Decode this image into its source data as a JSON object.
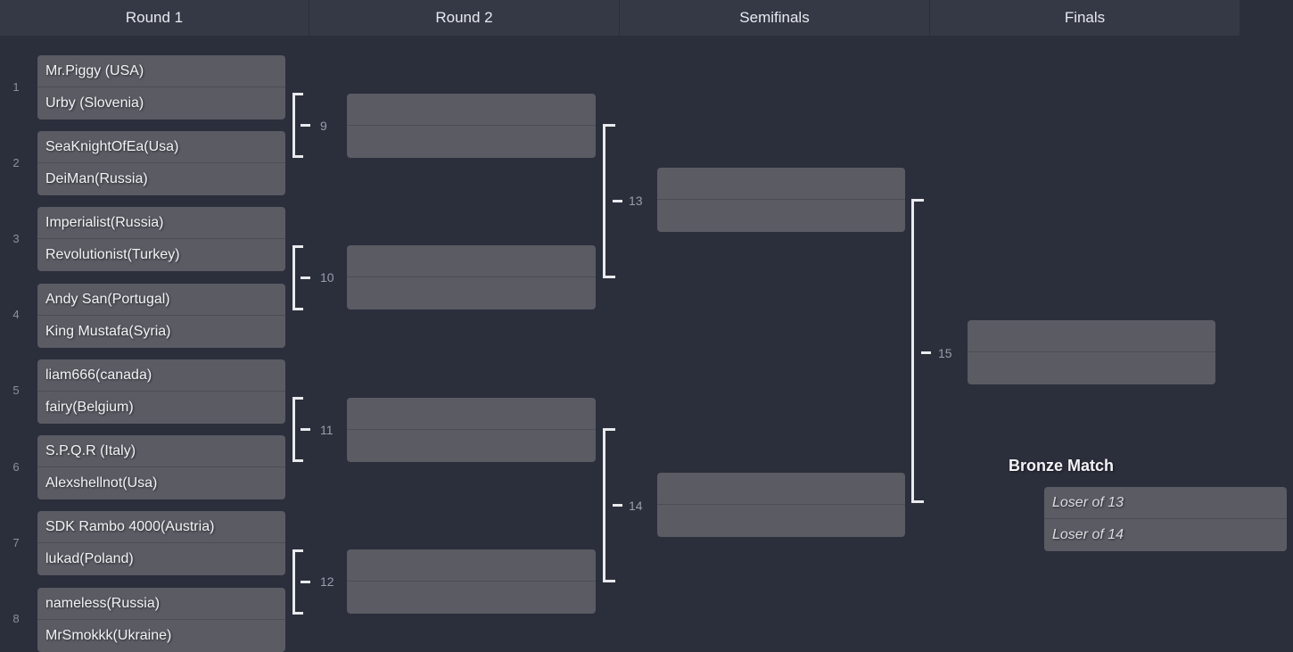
{
  "header": {
    "columns": [
      {
        "label": "Round 1"
      },
      {
        "label": "Round 2"
      },
      {
        "label": "Semifinals"
      },
      {
        "label": "Finals"
      }
    ]
  },
  "round1": {
    "matches": [
      {
        "number": "1",
        "top": "Mr.Piggy (USA)",
        "bottom": "Urby (Slovenia)"
      },
      {
        "number": "2",
        "top": "SeaKnightOfEa(Usa)",
        "bottom": "DeiMan(Russia)"
      },
      {
        "number": "3",
        "top": "Imperialist(Russia)",
        "bottom": "Revolutionist(Turkey)"
      },
      {
        "number": "4",
        "top": "Andy San(Portugal)",
        "bottom": "King Mustafa(Syria)"
      },
      {
        "number": "5",
        "top": "liam666(canada)",
        "bottom": "fairy(Belgium)"
      },
      {
        "number": "6",
        "top": "S.P.Q.R (Italy)",
        "bottom": "Alexshellnot(Usa)"
      },
      {
        "number": "7",
        "top": "SDK Rambo 4000(Austria)",
        "bottom": "lukad(Poland)"
      },
      {
        "number": "8",
        "top": "nameless(Russia)",
        "bottom": "MrSmokkk(Ukraine)"
      }
    ]
  },
  "round2": {
    "matches": [
      {
        "number": "9",
        "top": "",
        "bottom": ""
      },
      {
        "number": "10",
        "top": "",
        "bottom": ""
      },
      {
        "number": "11",
        "top": "",
        "bottom": ""
      },
      {
        "number": "12",
        "top": "",
        "bottom": ""
      }
    ]
  },
  "semifinals": {
    "matches": [
      {
        "number": "13",
        "top": "",
        "bottom": ""
      },
      {
        "number": "14",
        "top": "",
        "bottom": ""
      }
    ]
  },
  "finals": {
    "matches": [
      {
        "number": "15",
        "top": "",
        "bottom": ""
      }
    ]
  },
  "bronze": {
    "title": "Bronze Match",
    "match": {
      "top": "Loser of 13",
      "bottom": "Loser of 14"
    }
  },
  "colors": {
    "background": "#2b2e3b",
    "header_bar": "#353946",
    "box_fill": "#5a5b63",
    "box_divider": "#4b4c54",
    "connector": "#e9eaee",
    "text": "#f2f3f6",
    "muted_text": "#9a9dab"
  }
}
